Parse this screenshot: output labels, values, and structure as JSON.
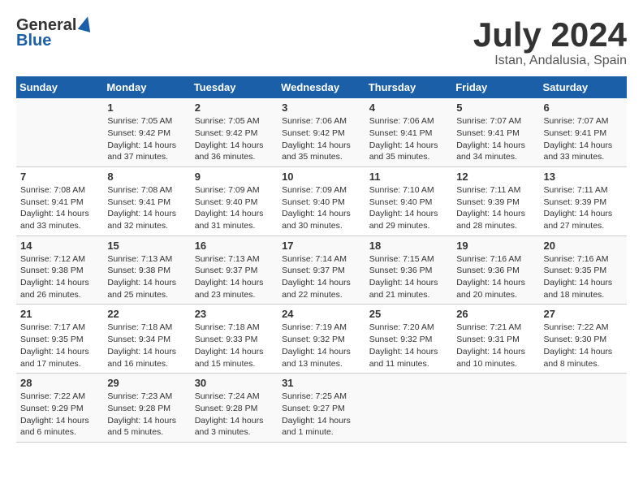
{
  "header": {
    "logo_general": "General",
    "logo_blue": "Blue",
    "month": "July 2024",
    "location": "Istan, Andalusia, Spain"
  },
  "weekdays": [
    "Sunday",
    "Monday",
    "Tuesday",
    "Wednesday",
    "Thursday",
    "Friday",
    "Saturday"
  ],
  "rows": [
    [
      {
        "num": "",
        "info": ""
      },
      {
        "num": "1",
        "info": "Sunrise: 7:05 AM\nSunset: 9:42 PM\nDaylight: 14 hours\nand 37 minutes."
      },
      {
        "num": "2",
        "info": "Sunrise: 7:05 AM\nSunset: 9:42 PM\nDaylight: 14 hours\nand 36 minutes."
      },
      {
        "num": "3",
        "info": "Sunrise: 7:06 AM\nSunset: 9:42 PM\nDaylight: 14 hours\nand 35 minutes."
      },
      {
        "num": "4",
        "info": "Sunrise: 7:06 AM\nSunset: 9:41 PM\nDaylight: 14 hours\nand 35 minutes."
      },
      {
        "num": "5",
        "info": "Sunrise: 7:07 AM\nSunset: 9:41 PM\nDaylight: 14 hours\nand 34 minutes."
      },
      {
        "num": "6",
        "info": "Sunrise: 7:07 AM\nSunset: 9:41 PM\nDaylight: 14 hours\nand 33 minutes."
      }
    ],
    [
      {
        "num": "7",
        "info": "Sunrise: 7:08 AM\nSunset: 9:41 PM\nDaylight: 14 hours\nand 33 minutes."
      },
      {
        "num": "8",
        "info": "Sunrise: 7:08 AM\nSunset: 9:41 PM\nDaylight: 14 hours\nand 32 minutes."
      },
      {
        "num": "9",
        "info": "Sunrise: 7:09 AM\nSunset: 9:40 PM\nDaylight: 14 hours\nand 31 minutes."
      },
      {
        "num": "10",
        "info": "Sunrise: 7:09 AM\nSunset: 9:40 PM\nDaylight: 14 hours\nand 30 minutes."
      },
      {
        "num": "11",
        "info": "Sunrise: 7:10 AM\nSunset: 9:40 PM\nDaylight: 14 hours\nand 29 minutes."
      },
      {
        "num": "12",
        "info": "Sunrise: 7:11 AM\nSunset: 9:39 PM\nDaylight: 14 hours\nand 28 minutes."
      },
      {
        "num": "13",
        "info": "Sunrise: 7:11 AM\nSunset: 9:39 PM\nDaylight: 14 hours\nand 27 minutes."
      }
    ],
    [
      {
        "num": "14",
        "info": "Sunrise: 7:12 AM\nSunset: 9:38 PM\nDaylight: 14 hours\nand 26 minutes."
      },
      {
        "num": "15",
        "info": "Sunrise: 7:13 AM\nSunset: 9:38 PM\nDaylight: 14 hours\nand 25 minutes."
      },
      {
        "num": "16",
        "info": "Sunrise: 7:13 AM\nSunset: 9:37 PM\nDaylight: 14 hours\nand 23 minutes."
      },
      {
        "num": "17",
        "info": "Sunrise: 7:14 AM\nSunset: 9:37 PM\nDaylight: 14 hours\nand 22 minutes."
      },
      {
        "num": "18",
        "info": "Sunrise: 7:15 AM\nSunset: 9:36 PM\nDaylight: 14 hours\nand 21 minutes."
      },
      {
        "num": "19",
        "info": "Sunrise: 7:16 AM\nSunset: 9:36 PM\nDaylight: 14 hours\nand 20 minutes."
      },
      {
        "num": "20",
        "info": "Sunrise: 7:16 AM\nSunset: 9:35 PM\nDaylight: 14 hours\nand 18 minutes."
      }
    ],
    [
      {
        "num": "21",
        "info": "Sunrise: 7:17 AM\nSunset: 9:35 PM\nDaylight: 14 hours\nand 17 minutes."
      },
      {
        "num": "22",
        "info": "Sunrise: 7:18 AM\nSunset: 9:34 PM\nDaylight: 14 hours\nand 16 minutes."
      },
      {
        "num": "23",
        "info": "Sunrise: 7:18 AM\nSunset: 9:33 PM\nDaylight: 14 hours\nand 15 minutes."
      },
      {
        "num": "24",
        "info": "Sunrise: 7:19 AM\nSunset: 9:32 PM\nDaylight: 14 hours\nand 13 minutes."
      },
      {
        "num": "25",
        "info": "Sunrise: 7:20 AM\nSunset: 9:32 PM\nDaylight: 14 hours\nand 11 minutes."
      },
      {
        "num": "26",
        "info": "Sunrise: 7:21 AM\nSunset: 9:31 PM\nDaylight: 14 hours\nand 10 minutes."
      },
      {
        "num": "27",
        "info": "Sunrise: 7:22 AM\nSunset: 9:30 PM\nDaylight: 14 hours\nand 8 minutes."
      }
    ],
    [
      {
        "num": "28",
        "info": "Sunrise: 7:22 AM\nSunset: 9:29 PM\nDaylight: 14 hours\nand 6 minutes."
      },
      {
        "num": "29",
        "info": "Sunrise: 7:23 AM\nSunset: 9:28 PM\nDaylight: 14 hours\nand 5 minutes."
      },
      {
        "num": "30",
        "info": "Sunrise: 7:24 AM\nSunset: 9:28 PM\nDaylight: 14 hours\nand 3 minutes."
      },
      {
        "num": "31",
        "info": "Sunrise: 7:25 AM\nSunset: 9:27 PM\nDaylight: 14 hours\nand 1 minute."
      },
      {
        "num": "",
        "info": ""
      },
      {
        "num": "",
        "info": ""
      },
      {
        "num": "",
        "info": ""
      }
    ]
  ]
}
